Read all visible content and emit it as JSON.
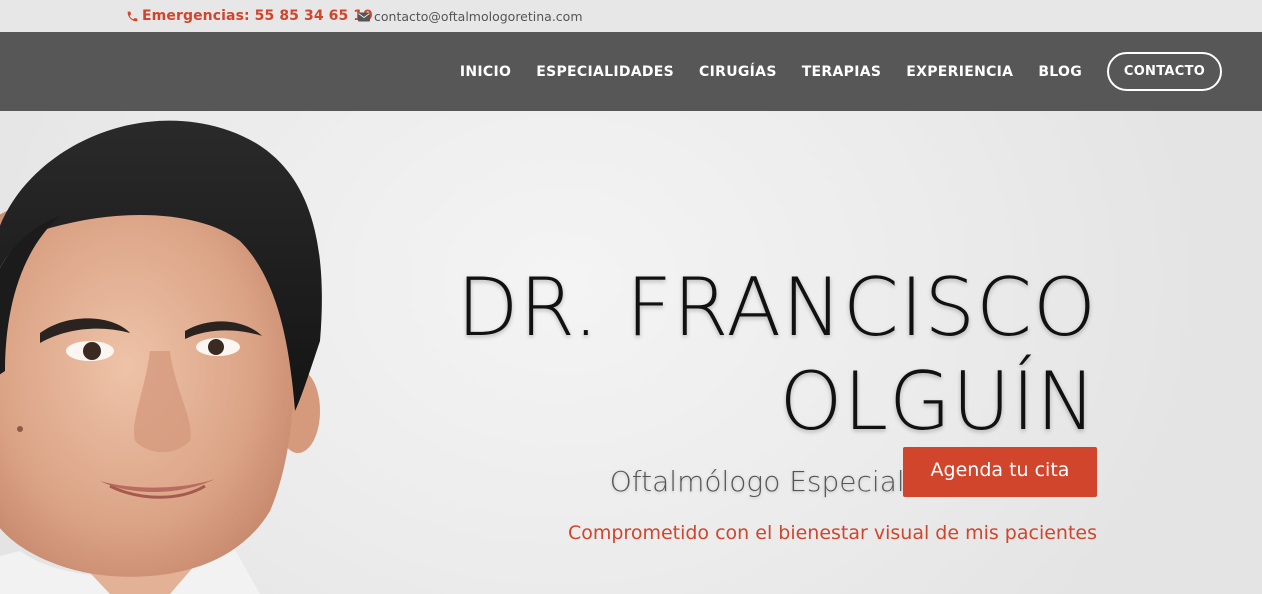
{
  "topbar": {
    "phone": "Emergencias: 55 85 34 65 19",
    "email": "contacto@oftalmologoretina.com",
    "phone_icon": "phone-icon",
    "email_icon": "envelope-icon",
    "accent_color": "#d0452b"
  },
  "nav": {
    "items": [
      {
        "label": "INICIO"
      },
      {
        "label": "ESPECIALIDADES"
      },
      {
        "label": "CIRUGÍAS"
      },
      {
        "label": "TERAPIAS"
      },
      {
        "label": "EXPERIENCIA"
      },
      {
        "label": "BLOG"
      }
    ],
    "contact_button": "CONTACTO",
    "background_color": "#575757"
  },
  "hero": {
    "title_line1": "DR. FRANCISCO",
    "title_line2": "OLGUÍN",
    "subtitle": "Oftalmólogo Especialista en Retina",
    "tagline": "Comprometido con el bienestar visual de mis pacientes",
    "cta_label": "Agenda tu cita",
    "cta_color": "#d0452b"
  }
}
